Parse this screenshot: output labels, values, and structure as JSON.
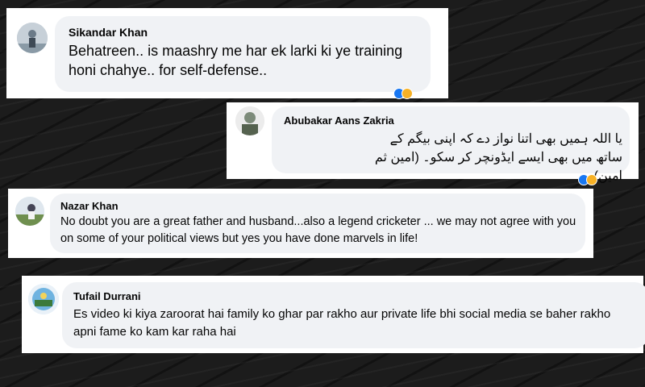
{
  "comments": [
    {
      "author": "Sikandar Khan",
      "text": "Behatreen.. is maashry me har ek larki ki ye training honi chahye.. for self-defense.."
    },
    {
      "author": "Abubakar Aans Zakria",
      "text": "یا اللہ ہمیں بھی اتنا نواز دے کہ اپنی بیگم کے ساتھ میں بھی ایسے ایڈونچر کر سکو۔ (امین ثم امین)"
    },
    {
      "author": "Nazar Khan",
      "text": "No doubt you are a great father and husband...also a legend cricketer ... we may not agree with you on some of your political views but yes you have done marvels in life!"
    },
    {
      "author": "Tufail Durrani",
      "text": "Es video ki kiya zaroorat hai family ko ghar par rakho aur private life bhi social media se baher rakho apni fame ko kam kar raha hai"
    }
  ],
  "colors": {
    "background": "#1c1c1c",
    "bubble": "#f0f2f5",
    "like": "#1877f2",
    "haha": "#f7b125"
  }
}
